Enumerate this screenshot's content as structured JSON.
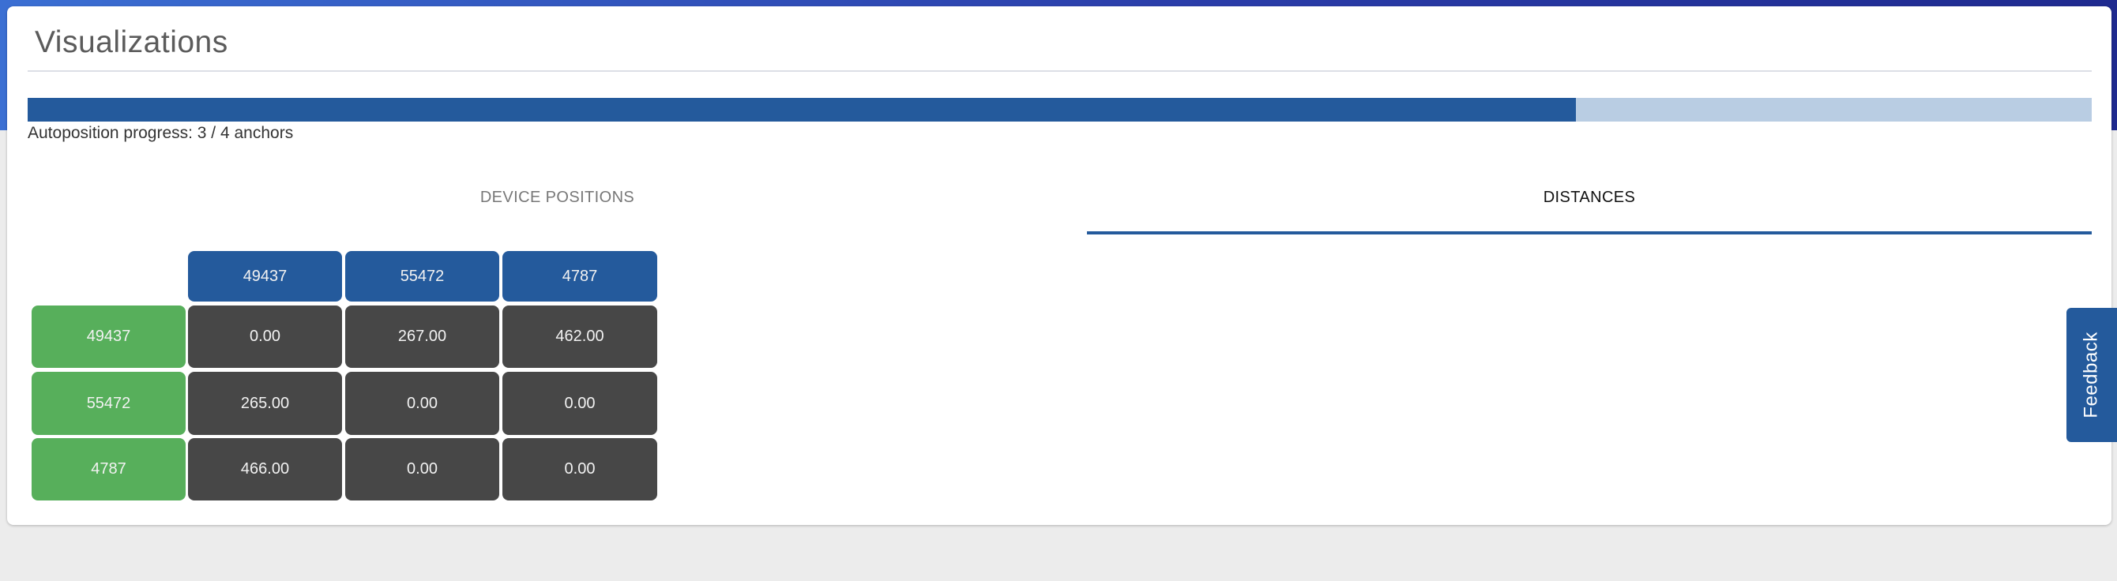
{
  "page": {
    "title": "Visualizations"
  },
  "progress": {
    "text": "Autoposition progress: 3 / 4 anchors",
    "fraction": 0.75,
    "color": "#245a9c",
    "track_color": "#b9cde3"
  },
  "tabs": [
    {
      "label": "DEVICE POSITIONS",
      "active": false
    },
    {
      "label": "DISTANCES",
      "active": true
    }
  ],
  "distances": {
    "columns": [
      "49437",
      "55472",
      "4787"
    ],
    "rows": [
      {
        "label": "49437",
        "values": [
          "0.00",
          "267.00",
          "462.00"
        ]
      },
      {
        "label": "55472",
        "values": [
          "265.00",
          "0.00",
          "0.00"
        ]
      },
      {
        "label": "4787",
        "values": [
          "466.00",
          "0.00",
          "0.00"
        ]
      }
    ],
    "colors": {
      "column_header": "#245a9c",
      "row_header": "#57af5b",
      "value_cell": "#474747"
    }
  },
  "feedback": {
    "label": "Feedback"
  }
}
